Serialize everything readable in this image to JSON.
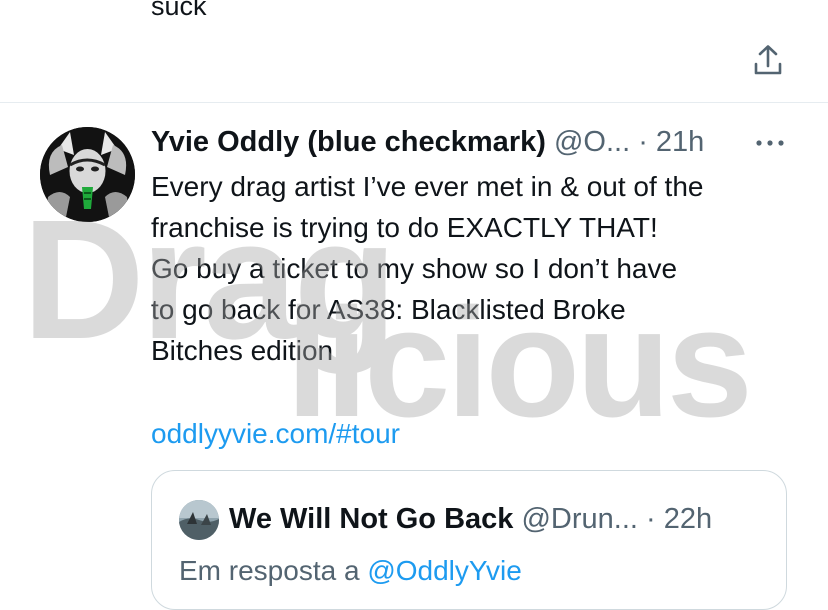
{
  "previous_tweet": {
    "text_tail": "suck",
    "share_icon": "share-upload-icon"
  },
  "tweet": {
    "author": {
      "display_name": "Yvie Oddly (blue checkmark)",
      "handle": "@O...",
      "avatar_icon": "avatar-image"
    },
    "separator": "·",
    "time": "21h",
    "more_icon": "more-options-icon",
    "body_lines": [
      "Every drag artist I’ve ever met in & out of the",
      "franchise is trying to do EXACTLY THAT!",
      "Go buy a ticket to my show so I don’t have",
      "to go back for AS38: Blacklisted Broke",
      "Bitches edition"
    ],
    "link": "oddlyyvie.com/#tour"
  },
  "quoted_tweet": {
    "author": {
      "display_name": "We Will Not Go Back",
      "handle": "@Drun...",
      "avatar_icon": "avatar-image"
    },
    "separator": "·",
    "time": "22h",
    "reply_prefix": "Em resposta a",
    "reply_mention": "@OddlyYvie"
  },
  "watermark": {
    "line1": "Drag",
    "line2": "licious"
  },
  "colors": {
    "link_blue": "#1d9bf0",
    "secondary_text": "#536471",
    "border": "#cfd9de",
    "watermark_gray": "#a9a9a9"
  }
}
